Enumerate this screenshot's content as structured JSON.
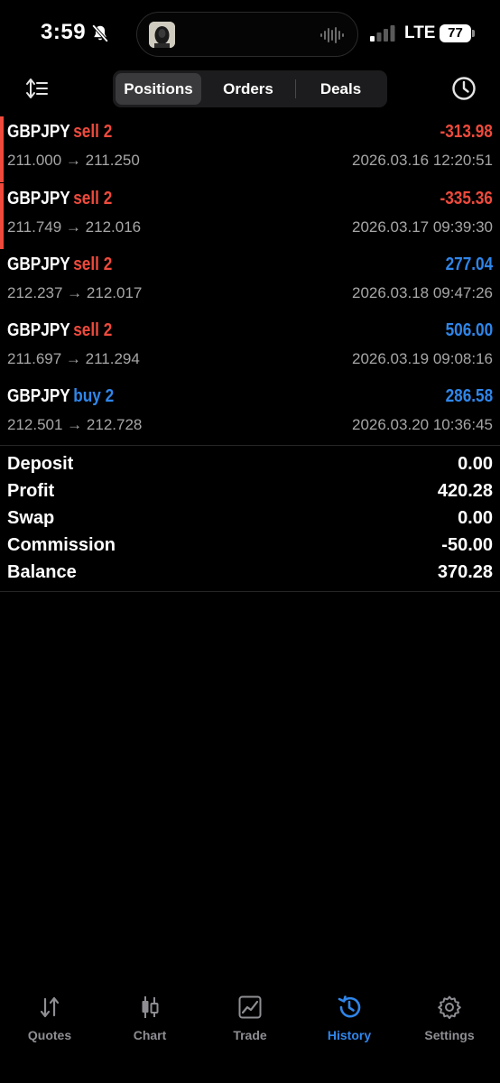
{
  "status_bar": {
    "time": "3:59",
    "carrier": "LTE",
    "battery": "77"
  },
  "header": {
    "tabs": [
      {
        "label": "Positions",
        "active": true
      },
      {
        "label": "Orders",
        "active": false
      },
      {
        "label": "Deals",
        "active": false
      }
    ]
  },
  "trades": [
    {
      "symbol": "GBPJPY",
      "side": "sell 2",
      "direction": "sell",
      "profit": "-313.98",
      "profit_color": "#ef4a3c",
      "open_price": "211.000",
      "close_price": "211.250",
      "time": "2026.03.16 12:20:51",
      "highlighted": true
    },
    {
      "symbol": "GBPJPY",
      "side": "sell 2",
      "direction": "sell",
      "profit": "-335.36",
      "profit_color": "#ef4a3c",
      "open_price": "211.749",
      "close_price": "212.016",
      "time": "2026.03.17 09:39:30",
      "highlighted": true
    },
    {
      "symbol": "GBPJPY",
      "side": "sell 2",
      "direction": "sell",
      "profit": "277.04",
      "profit_color": "#2f86ea",
      "open_price": "212.237",
      "close_price": "212.017",
      "time": "2026.03.18 09:47:26",
      "highlighted": false
    },
    {
      "symbol": "GBPJPY",
      "side": "sell 2",
      "direction": "sell",
      "profit": "506.00",
      "profit_color": "#2f86ea",
      "open_price": "211.697",
      "close_price": "211.294",
      "time": "2026.03.19 09:08:16",
      "highlighted": false
    },
    {
      "symbol": "GBPJPY",
      "side": "buy 2",
      "direction": "buy",
      "profit": "286.58",
      "profit_color": "#2f86ea",
      "open_price": "212.501",
      "close_price": "212.728",
      "time": "2026.03.20 10:36:45",
      "highlighted": false
    }
  ],
  "summary": {
    "deposit_label": "Deposit",
    "deposit": "0.00",
    "profit_label": "Profit",
    "profit": "420.28",
    "swap_label": "Swap",
    "swap": "0.00",
    "commission_label": "Commission",
    "commission": "-50.00",
    "balance_label": "Balance",
    "balance": "370.28"
  },
  "tabbar": {
    "items": [
      {
        "label": "Quotes",
        "icon": "quotes-icon",
        "active": false
      },
      {
        "label": "Chart",
        "icon": "chart-icon",
        "active": false
      },
      {
        "label": "Trade",
        "icon": "trade-icon",
        "active": false
      },
      {
        "label": "History",
        "icon": "history-icon",
        "active": true
      },
      {
        "label": "Settings",
        "icon": "settings-icon",
        "active": false
      }
    ]
  },
  "colors": {
    "sell": "#ef4a3c",
    "buy": "#2f86ea",
    "loss": "#ef4a3c",
    "gain": "#2f86ea",
    "background": "#000000",
    "secondary_text": "#a6a6a6"
  }
}
